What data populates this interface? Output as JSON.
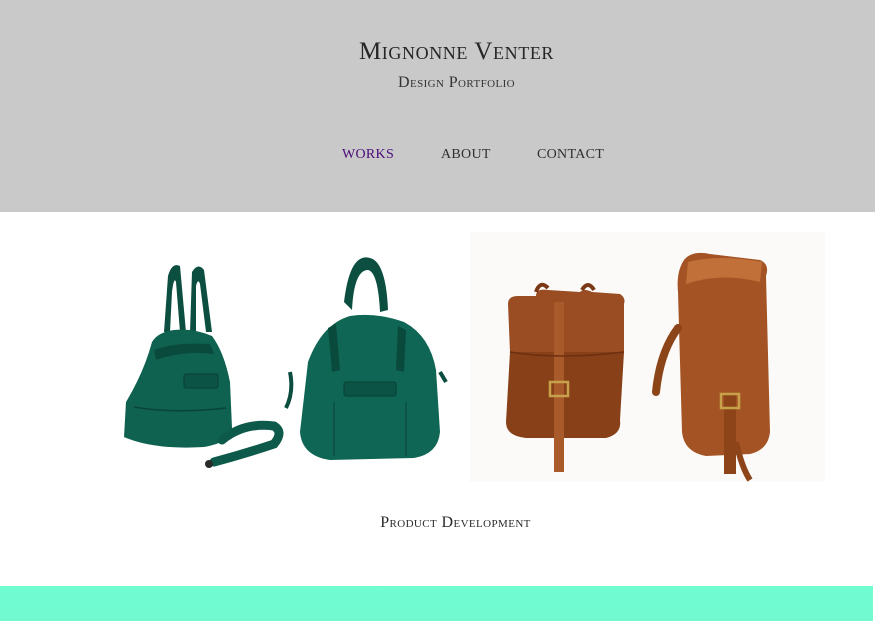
{
  "header": {
    "title": "Mignonne Venter",
    "subtitle": "Design Portfolio"
  },
  "nav": {
    "items": [
      {
        "label": "WORKS",
        "active": true
      },
      {
        "label": "ABOUT",
        "active": false
      },
      {
        "label": "CONTACT",
        "active": false
      }
    ]
  },
  "portfolio": {
    "items": [
      {
        "caption": "Product Development",
        "images": [
          "green-leather-bags-photo",
          "brown-leather-backpacks-photo"
        ]
      }
    ]
  },
  "colors": {
    "header_bg": "#c9c9c9",
    "nav_active": "#4b0a7a",
    "footer_bar": "#6ffdd0",
    "green_leather": "#0d5e4c",
    "brown_leather": "#9b4a22"
  }
}
